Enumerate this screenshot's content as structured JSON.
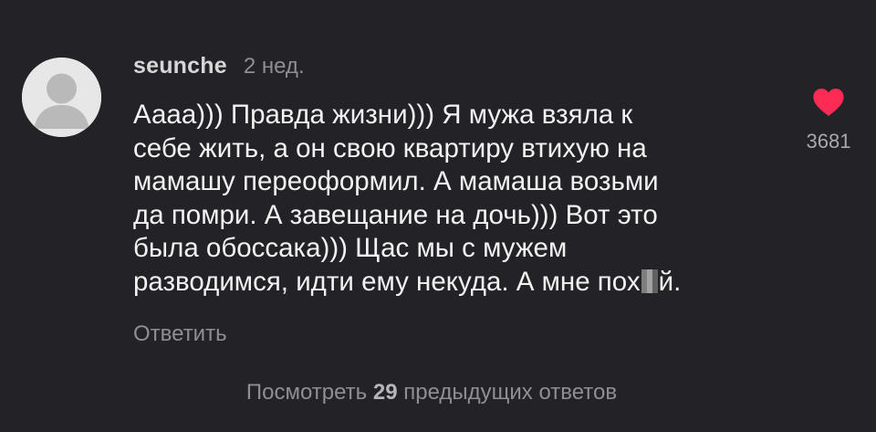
{
  "comment": {
    "username": "seunche",
    "time_ago": "2 нед.",
    "text_lines": [
      "Аааа))) Правда жизни))) Я мужа взяла к",
      "себе жить, а он свою квартиру втихую на",
      "мамашу переоформил. А мамаша возьми",
      "да помри. А завещание на дочь))) Вот это",
      "была обоссака))) Щас мы с мужем"
    ],
    "last_line_before": "разводимся, идти ему некуда. А мне пох",
    "last_line_after": "й.",
    "reply_label": "Ответить",
    "likes": "3681",
    "heart_icon": "heart-icon",
    "heart_color": "#fe2c55"
  },
  "view_replies": {
    "prefix": "Посмотреть",
    "count": "29",
    "suffix": "предыдущих ответов"
  },
  "colors": {
    "background": "#232327",
    "text": "#f2f2f2",
    "muted": "#8e8e93"
  }
}
